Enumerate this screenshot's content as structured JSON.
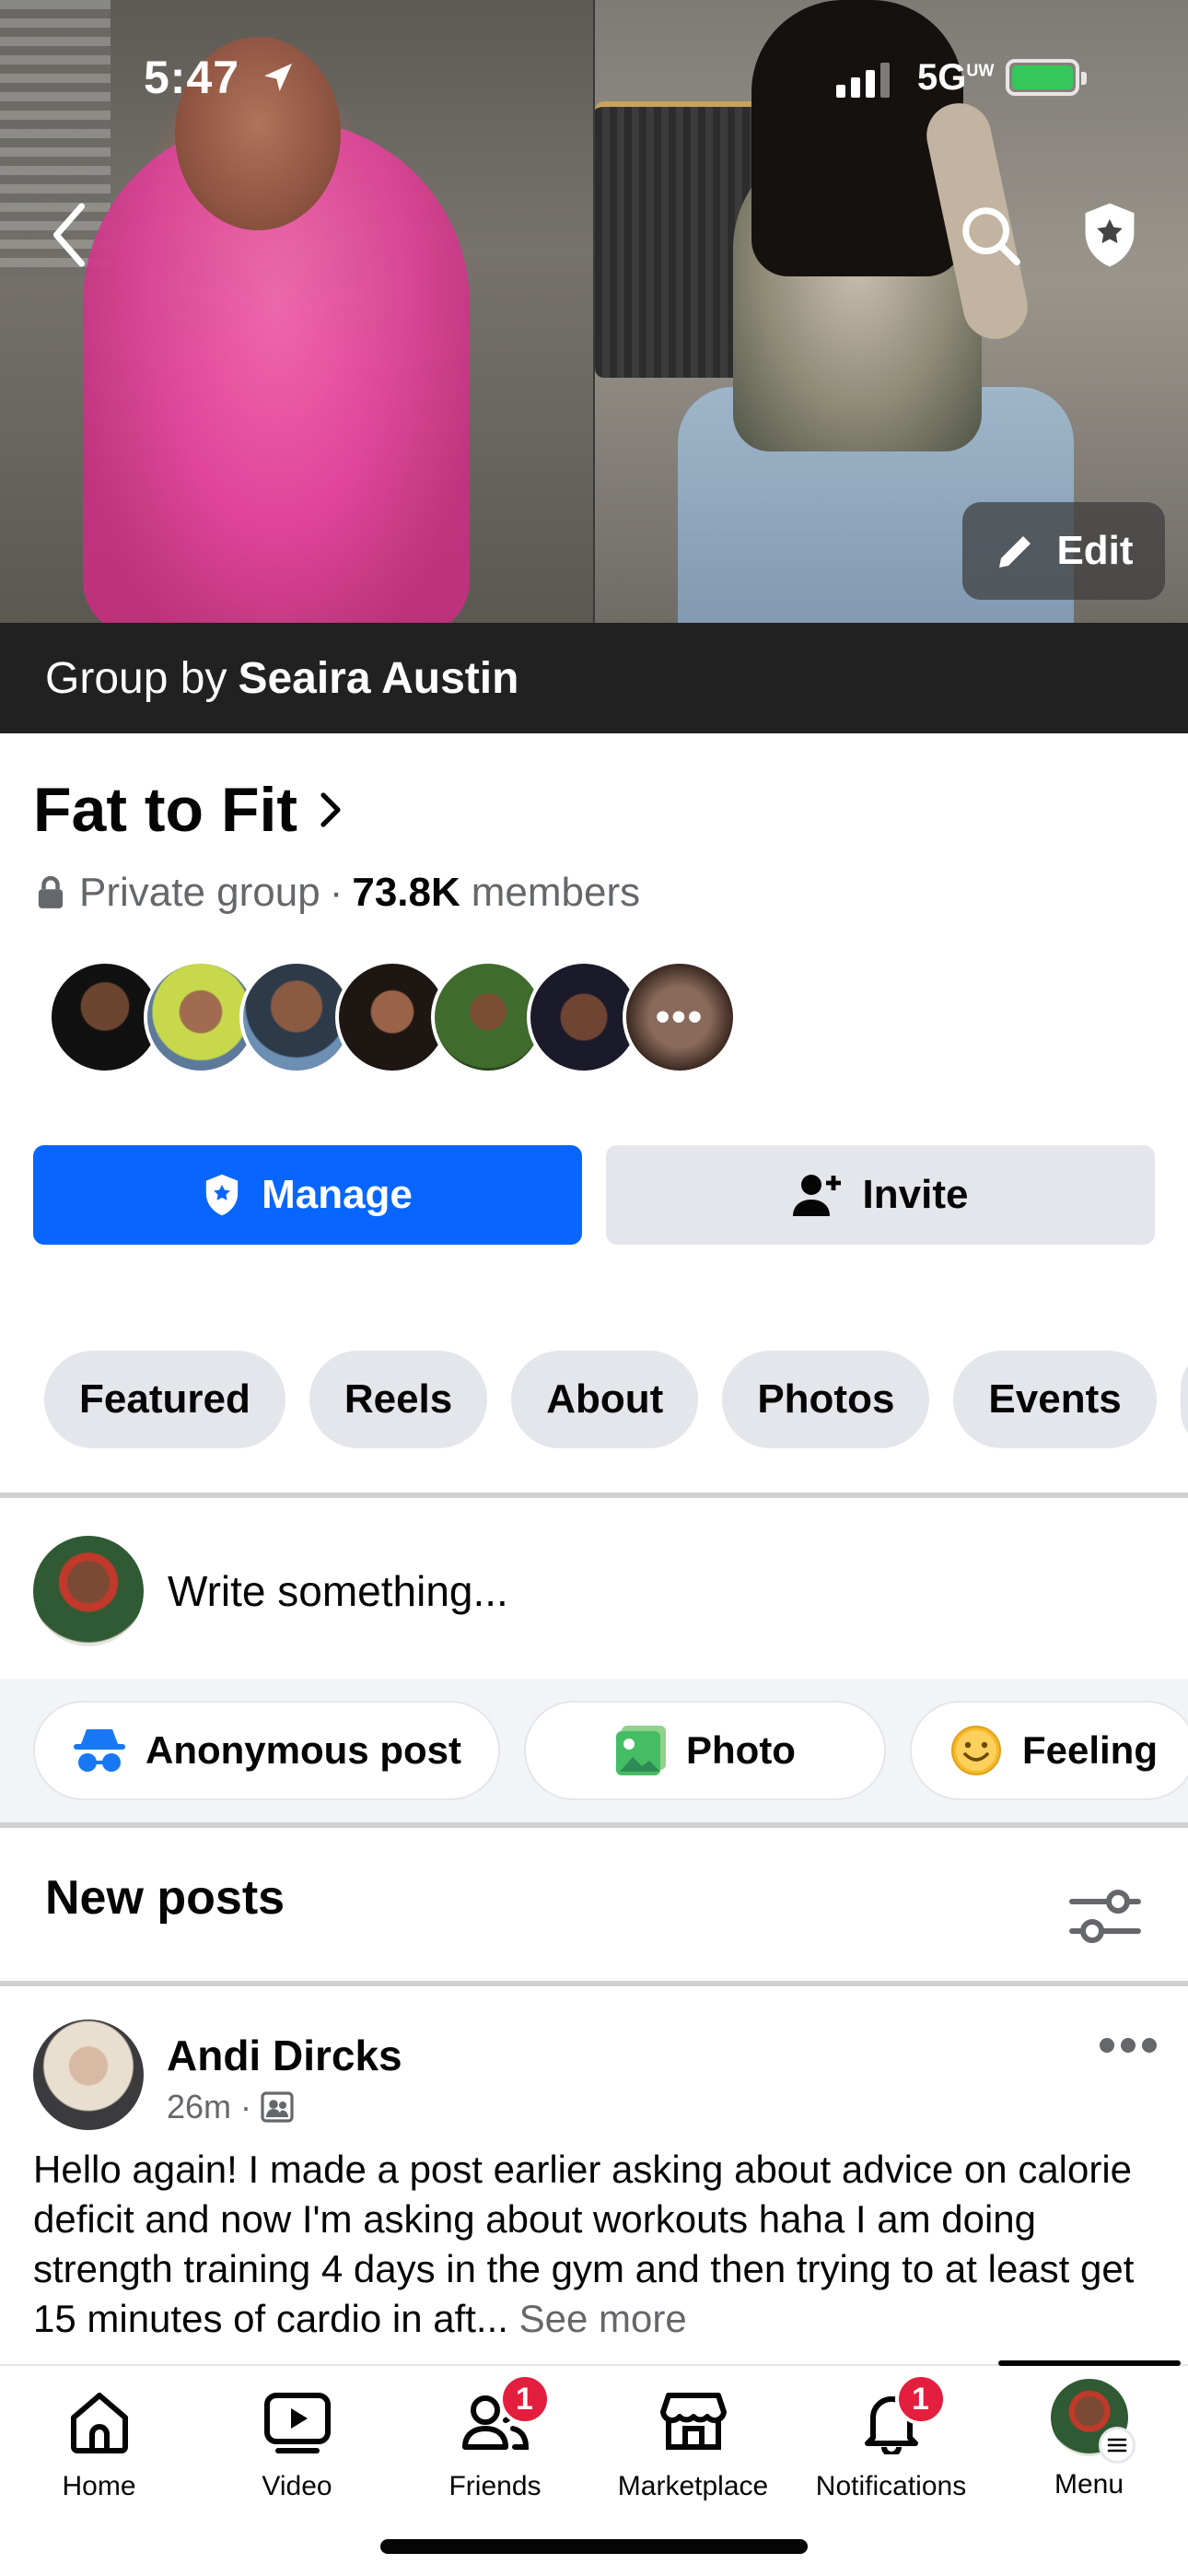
{
  "status_bar": {
    "time": "5:47",
    "network": "5G",
    "network_sup": "UW"
  },
  "cover": {
    "edit_label": "Edit",
    "group_by_prefix": "Group by",
    "group_by_name": "Seaira Austin"
  },
  "group": {
    "name": "Fat to Fit",
    "privacy": "Private group",
    "separator": "·",
    "member_count": "73.8K",
    "member_suffix": "members"
  },
  "actions": {
    "manage_label": "Manage",
    "invite_label": "Invite"
  },
  "tabs": [
    "Featured",
    "Reels",
    "About",
    "Photos",
    "Events"
  ],
  "composer": {
    "placeholder": "Write something..."
  },
  "chips": {
    "anonymous": "Anonymous post",
    "photo": "Photo",
    "feeling": "Feeling"
  },
  "feed": {
    "heading": "New posts"
  },
  "post": {
    "author": "Andi Dircks",
    "time": "26m",
    "separator": "·",
    "text": "Hello again! I made a post earlier asking about advice on calorie deficit and now I'm asking about workouts haha I am doing strength training 4 days in the gym and then trying to at least get 15 minutes of cardio in aft...",
    "see_more": "See more"
  },
  "bottom_nav": {
    "home": "Home",
    "video": "Video",
    "friends": "Friends",
    "friends_badge": "1",
    "marketplace": "Marketplace",
    "notifications": "Notifications",
    "notifications_badge": "1",
    "menu": "Menu"
  },
  "colors": {
    "brand_blue": "#0866ff",
    "badge_red": "#e41e3f",
    "chip_gray": "#e4e6eb",
    "secondary_text": "#65676b"
  }
}
